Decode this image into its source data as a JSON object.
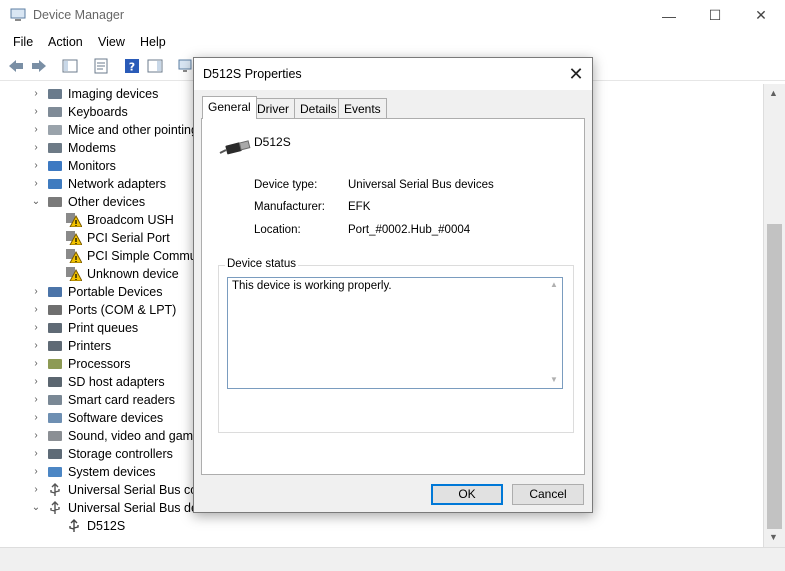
{
  "window": {
    "title": "Device Manager",
    "minimize": "—",
    "maximize": "☐",
    "close": "✕"
  },
  "menu": [
    "File",
    "Action",
    "View",
    "Help"
  ],
  "tree": {
    "items": [
      {
        "label": "Imaging devices",
        "expander": "›",
        "icon": "camera-icon"
      },
      {
        "label": "Keyboards",
        "expander": "›",
        "icon": "keyboard-icon"
      },
      {
        "label": "Mice and other pointing",
        "expander": "›",
        "icon": "mouse-icon"
      },
      {
        "label": "Modems",
        "expander": "›",
        "icon": "modem-icon"
      },
      {
        "label": "Monitors",
        "expander": "›",
        "icon": "monitor-icon"
      },
      {
        "label": "Network adapters",
        "expander": "›",
        "icon": "network-icon"
      },
      {
        "label": "Other devices",
        "expander": "⌄",
        "icon": "unknown-device-icon"
      },
      {
        "label": "Broadcom USH",
        "expander": "",
        "icon": "warning-icon"
      },
      {
        "label": "PCI Serial Port",
        "expander": "",
        "icon": "warning-icon"
      },
      {
        "label": "PCI Simple Commu",
        "expander": "",
        "icon": "warning-icon"
      },
      {
        "label": "Unknown device",
        "expander": "",
        "icon": "warning-icon"
      },
      {
        "label": "Portable Devices",
        "expander": "›",
        "icon": "portable-icon"
      },
      {
        "label": "Ports (COM & LPT)",
        "expander": "›",
        "icon": "port-icon"
      },
      {
        "label": "Print queues",
        "expander": "›",
        "icon": "printer-icon"
      },
      {
        "label": "Printers",
        "expander": "›",
        "icon": "printer-icon"
      },
      {
        "label": "Processors",
        "expander": "›",
        "icon": "processor-icon"
      },
      {
        "label": "SD host adapters",
        "expander": "›",
        "icon": "sd-card-icon"
      },
      {
        "label": "Smart card readers",
        "expander": "›",
        "icon": "smart-card-icon"
      },
      {
        "label": "Software devices",
        "expander": "›",
        "icon": "software-icon"
      },
      {
        "label": "Sound, video and game",
        "expander": "›",
        "icon": "sound-icon"
      },
      {
        "label": "Storage controllers",
        "expander": "›",
        "icon": "storage-icon"
      },
      {
        "label": "System devices",
        "expander": "›",
        "icon": "system-icon"
      },
      {
        "label": "Universal Serial Bus cont",
        "expander": "›",
        "icon": "usb-icon"
      },
      {
        "label": "Universal Serial Bus devi",
        "expander": "⌄",
        "icon": "usb-icon"
      },
      {
        "label": "D512S",
        "expander": "",
        "icon": "usb-plug-icon"
      }
    ]
  },
  "dialog": {
    "title": "D512S Properties",
    "close": "✕",
    "tabs": [
      "General",
      "Driver",
      "Details",
      "Events"
    ],
    "device_name": "D512S",
    "properties": [
      {
        "label": "Device type:",
        "value": "Universal Serial Bus devices"
      },
      {
        "label": "Manufacturer:",
        "value": "EFK"
      },
      {
        "label": "Location:",
        "value": "Port_#0002.Hub_#0004"
      }
    ],
    "status_legend": "Device status",
    "status_text": "This device is working properly.",
    "ok_label": "OK",
    "cancel_label": "Cancel"
  },
  "colors": {
    "accent": "#0078d7",
    "warning": "#f2c300",
    "dialog_bg": "#f0f0f0"
  }
}
